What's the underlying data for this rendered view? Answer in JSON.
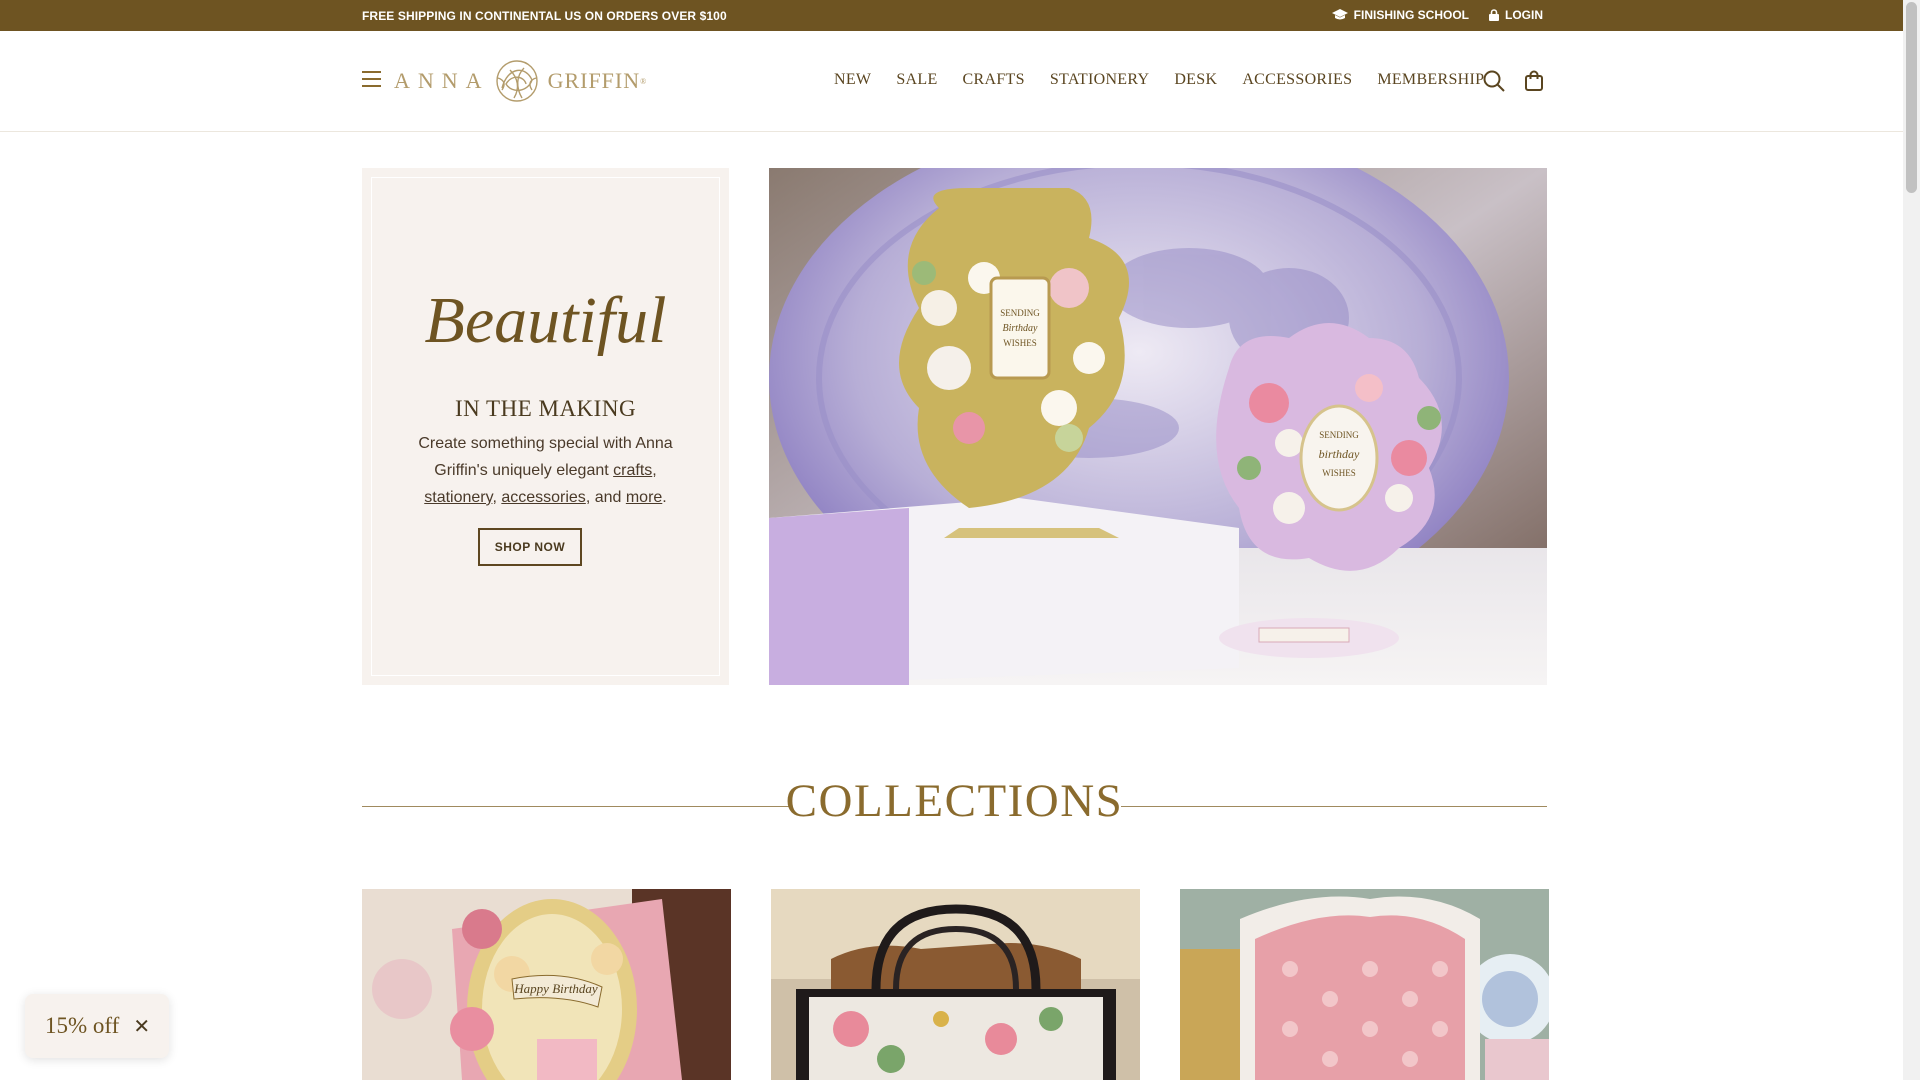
{
  "announcement": {
    "shipping": "FREE SHIPPING IN CONTINENTAL US ON ORDERS OVER $100",
    "finishing_school": "FINISHING SCHOOL",
    "login": "LOGIN"
  },
  "header": {
    "logo_left": "ANNA",
    "logo_right": "GRIFFIN",
    "logo_mark": "®",
    "nav": [
      "NEW",
      "SALE",
      "CRAFTS",
      "STATIONERY",
      "DESK",
      "ACCESSORIES",
      "MEMBERSHIP"
    ]
  },
  "hero": {
    "script_title": "Beautiful",
    "subtitle": "IN THE MAKING",
    "text_1": "Create something special with Anna Griffin's uniquely elegant ",
    "link_crafts": "crafts",
    "text_2": ", ",
    "link_stationery": "stationery",
    "text_3": ", ",
    "link_accessories": "accessories",
    "text_4": ", and ",
    "link_more": "more",
    "text_5": ".",
    "button": "SHOP NOW",
    "card_1_text": [
      "SENDING",
      "Birthday",
      "WISHES"
    ],
    "card_2_text": [
      "SENDING",
      "birthday",
      "WISHES"
    ]
  },
  "collections": {
    "title": "COLLECTIONS",
    "card_1_text": "Happy Birthday"
  },
  "discount": {
    "label": "15% off",
    "close": "✕"
  },
  "colors": {
    "announcement_bg": "#6e5422",
    "accent_gold": "#8a6b2e",
    "card_bg": "#f7f2ee"
  }
}
